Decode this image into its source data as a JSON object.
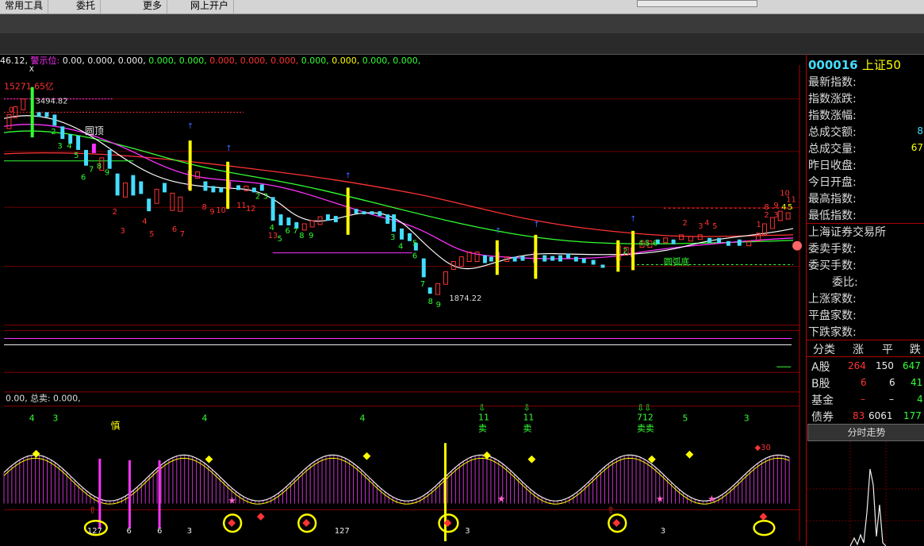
{
  "menu": {
    "items": [
      "常用工具",
      "委托",
      "更多",
      "网上开户"
    ]
  },
  "info_line": {
    "prefix": "46.12,",
    "label": "警示位:",
    "values": [
      "0.00,",
      "0.000,",
      "0.000,",
      "0.000,",
      "0.000,",
      "0.000,",
      "0.000,",
      "0.000,",
      "0.000,",
      "0.000,",
      "0.000,",
      "0.000,"
    ]
  },
  "main_chart": {
    "top_left_label": "15271 65亿",
    "x_marker": "X",
    "high_price_label": "3494.82",
    "low_price_label": "1874.22",
    "pattern_top": "圆顶",
    "pattern_bottom": "圆弧底"
  },
  "sub_chart": {
    "label": "0.00, 总卖: 0.000,",
    "top_numbers": [
      "4",
      "3",
      "4",
      "4",
      "5",
      "3"
    ],
    "note_cautious": "慎",
    "sell_signals": [
      "11\n卖",
      "11\n卖",
      "712\n卖卖"
    ],
    "bottom_numbers": [
      "127",
      "6",
      "6",
      "3",
      "127",
      "3",
      "3"
    ]
  },
  "panel": {
    "code": "000016",
    "name": "上证50",
    "fields": [
      "最新指数:",
      "指数涨跌:",
      "指数涨幅:",
      "总成交额:",
      "总成交量:",
      "昨日收盘:",
      "今日开盘:",
      "最高指数:",
      "最低指数:"
    ],
    "field_values": {
      "turnover": "8",
      "volume": "67"
    },
    "exchange": "上海证券交易所",
    "fields2": [
      "委卖手数:",
      "委买手数:",
      "委比:",
      "上涨家数:",
      "平盘家数:",
      "下跌家数:"
    ],
    "table_headers": [
      "分类",
      "涨",
      "平",
      "跌"
    ],
    "table_rows": [
      {
        "name": "A股",
        "up": "264",
        "flat": "150",
        "down": "647"
      },
      {
        "name": "B股",
        "up": "6",
        "flat": "6",
        "down": "41"
      },
      {
        "name": "基金",
        "up": "–",
        "flat": "–",
        "down": "4"
      },
      {
        "name": "债券",
        "up": "83",
        "flat": "6061",
        "down": "177"
      }
    ],
    "tab_label": "分时走势"
  },
  "colors": {
    "up": "#ff3333",
    "down": "#33ffff",
    "ma1": "#ffffff",
    "ma2": "#ff33ff",
    "ma3": "#33ff33",
    "ma4": "#ff3333",
    "signal": "#ffff00"
  }
}
